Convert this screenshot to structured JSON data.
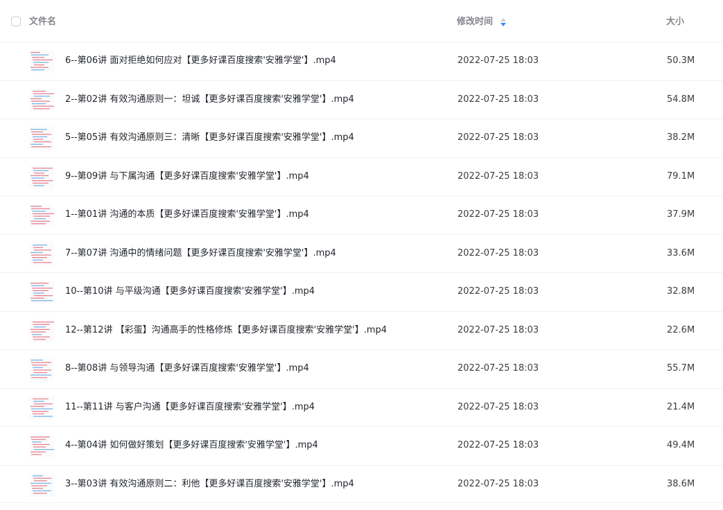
{
  "header": {
    "name_label": "文件名",
    "time_label": "修改时间",
    "size_label": "大小"
  },
  "colors": {
    "sort_up": "#c9cdd4",
    "sort_down": "#2f8cff",
    "thumb_red": "#e05a6a",
    "thumb_blue": "#4a9de0"
  },
  "files": [
    {
      "name": "6--第06讲 面对拒绝如何应对【更多好课百度搜索'安雅学堂'】.mp4",
      "modified": "2022-07-25 18:03",
      "size": "50.3M",
      "icon": "video-thumbnail-icon"
    },
    {
      "name": "2--第02讲 有效沟通原则一：坦诚【更多好课百度搜索'安雅学堂'】.mp4",
      "modified": "2022-07-25 18:03",
      "size": "54.8M",
      "icon": "video-thumbnail-icon"
    },
    {
      "name": "5--第05讲 有效沟通原则三：清晰【更多好课百度搜索'安雅学堂'】.mp4",
      "modified": "2022-07-25 18:03",
      "size": "38.2M",
      "icon": "video-thumbnail-icon"
    },
    {
      "name": "9--第09讲 与下属沟通【更多好课百度搜索'安雅学堂'】.mp4",
      "modified": "2022-07-25 18:03",
      "size": "79.1M",
      "icon": "video-thumbnail-icon"
    },
    {
      "name": "1--第01讲 沟通的本质【更多好课百度搜索'安雅学堂'】.mp4",
      "modified": "2022-07-25 18:03",
      "size": "37.9M",
      "icon": "video-thumbnail-icon"
    },
    {
      "name": "7--第07讲 沟通中的情绪问题【更多好课百度搜索'安雅学堂'】.mp4",
      "modified": "2022-07-25 18:03",
      "size": "33.6M",
      "icon": "video-thumbnail-icon"
    },
    {
      "name": "10--第10讲 与平级沟通【更多好课百度搜索'安雅学堂'】.mp4",
      "modified": "2022-07-25 18:03",
      "size": "32.8M",
      "icon": "video-thumbnail-icon"
    },
    {
      "name": "12--第12讲 【彩蛋】沟通高手的性格修炼【更多好课百度搜索'安雅学堂'】.mp4",
      "modified": "2022-07-25 18:03",
      "size": "22.6M",
      "icon": "video-thumbnail-icon"
    },
    {
      "name": "8--第08讲 与领导沟通【更多好课百度搜索'安雅学堂'】.mp4",
      "modified": "2022-07-25 18:03",
      "size": "55.7M",
      "icon": "video-thumbnail-icon"
    },
    {
      "name": "11--第11讲 与客户沟通【更多好课百度搜索'安雅学堂'】.mp4",
      "modified": "2022-07-25 18:03",
      "size": "21.4M",
      "icon": "video-thumbnail-icon"
    },
    {
      "name": "4--第04讲 如何做好策划【更多好课百度搜索'安雅学堂'】.mp4",
      "modified": "2022-07-25 18:03",
      "size": "49.4M",
      "icon": "video-thumbnail-icon"
    },
    {
      "name": "3--第03讲 有效沟通原则二：利他【更多好课百度搜索'安雅学堂'】.mp4",
      "modified": "2022-07-25 18:03",
      "size": "38.6M",
      "icon": "video-thumbnail-icon"
    }
  ]
}
